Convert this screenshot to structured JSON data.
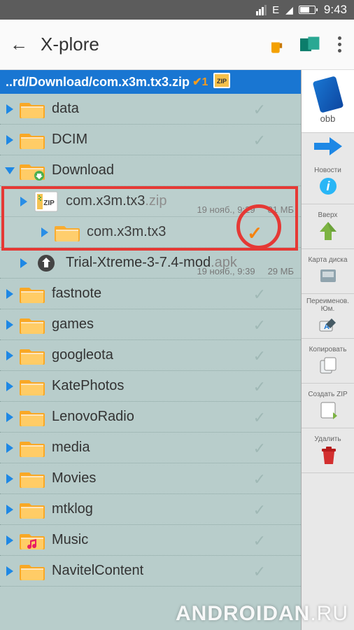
{
  "status": {
    "network": "E",
    "time": "9:43"
  },
  "appbar": {
    "title": "X-plore"
  },
  "breadcrumb": {
    "pre": "..rd/Download/",
    "file": "com.x3m.tx3.zip"
  },
  "items": [
    {
      "name": "data",
      "type": "folder",
      "indent": 0
    },
    {
      "name": "DCIM",
      "type": "folder",
      "indent": 0
    },
    {
      "name": "Download",
      "type": "folder",
      "indent": 0,
      "expanded": true,
      "marked": true
    },
    {
      "name": "com.x3m.tx3",
      "ext": ".zip",
      "type": "zip",
      "indent": 1,
      "date": "19 нояб., 9:29",
      "size": "81 МБ"
    },
    {
      "name": "com.x3m.tx3",
      "type": "folder",
      "indent": 2,
      "checked": true
    },
    {
      "name": "Trial-Xtreme-3-7.4-mod",
      "ext": ".apk",
      "type": "apk",
      "indent": 1,
      "date": "19 нояб., 9:39",
      "size": "29 МБ"
    },
    {
      "name": "fastnote",
      "type": "folder",
      "indent": 0
    },
    {
      "name": "games",
      "type": "folder",
      "indent": 0
    },
    {
      "name": "googleota",
      "type": "folder",
      "indent": 0
    },
    {
      "name": "KatePhotos",
      "type": "folder",
      "indent": 0
    },
    {
      "name": "LenovoRadio",
      "type": "folder",
      "indent": 0
    },
    {
      "name": "media",
      "type": "folder",
      "indent": 0
    },
    {
      "name": "Movies",
      "type": "folder",
      "indent": 0
    },
    {
      "name": "mtklog",
      "type": "folder",
      "indent": 0
    },
    {
      "name": "Music",
      "type": "folder-music",
      "indent": 0
    },
    {
      "name": "NavitelContent",
      "type": "folder",
      "indent": 0
    }
  ],
  "sidebar": {
    "top_label": "obb",
    "items": [
      {
        "label": "Новости",
        "icon": "info"
      },
      {
        "label": "Вверх",
        "icon": "up"
      },
      {
        "label": "Карта диска",
        "icon": "disk"
      },
      {
        "label": "Переименов. Юм.",
        "icon": "rename"
      },
      {
        "label": "Копировать",
        "icon": "copy"
      },
      {
        "label": "Создать ZIP",
        "icon": "zip"
      },
      {
        "label": "Удалить",
        "icon": "trash"
      }
    ]
  },
  "watermark": {
    "main": "ANDROIDAN",
    "suffix": ".RU"
  }
}
